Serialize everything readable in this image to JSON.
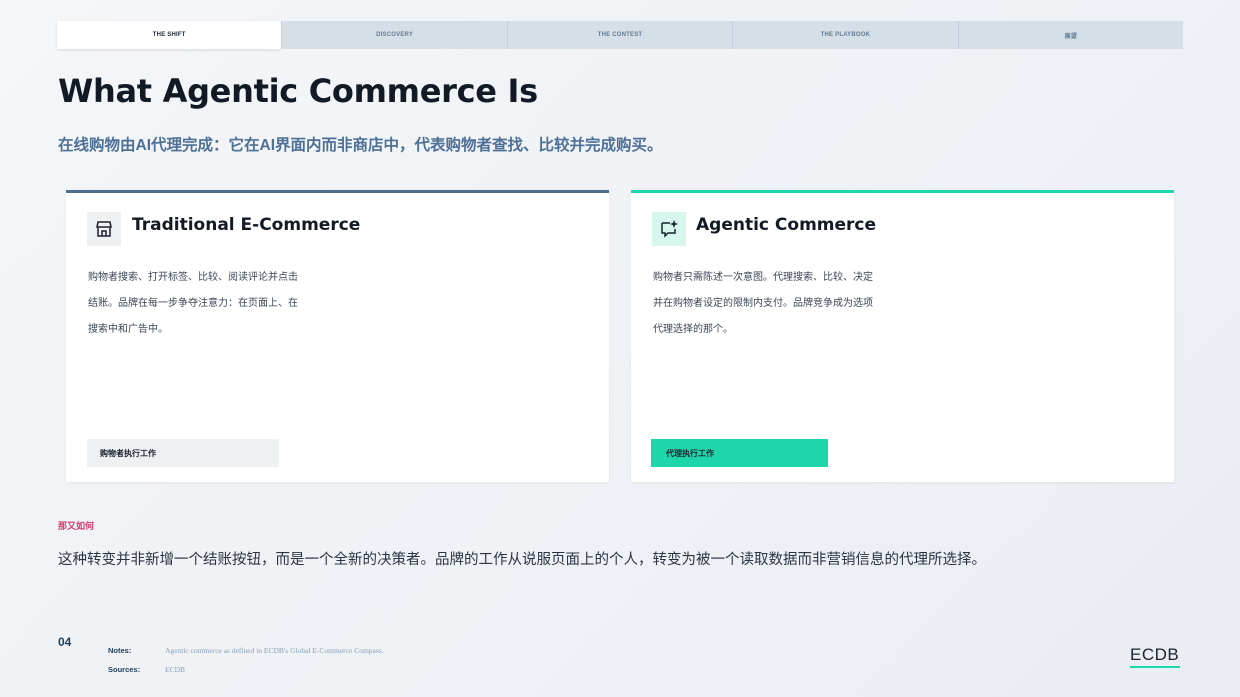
{
  "nav": {
    "tabs": [
      {
        "label": "THE SHIFT"
      },
      {
        "label": "DISCOVERY"
      },
      {
        "label": "THE CONTEST"
      },
      {
        "label": "THE PLAYBOOK"
      },
      {
        "label": "展望"
      }
    ],
    "active_index": 0
  },
  "page": {
    "title": "What Agentic Commerce Is",
    "subtitle": "在线购物由AI代理完成：它在AI界面内而非商店中，代表购物者查找、比较并完成购买。"
  },
  "cards": {
    "traditional": {
      "icon": "storefront-icon",
      "accent": "#4d6f8f",
      "title": "Traditional E-Commerce",
      "body_lines": [
        "购物者搜索、打开标签、比较、阅读评论并点击",
        "结账。品牌在每一步争夺注意力：在页面上、在",
        "搜索中和广告中。"
      ],
      "tag": "购物者执行工作"
    },
    "agentic": {
      "icon": "sparkle-chat-icon",
      "accent": "#1fd6ac",
      "title": "Agentic Commerce",
      "body_lines": [
        "购物者只需陈述一次意图。代理搜索、比较、决定",
        "并在购物者设定的限制内支付。品牌竞争成为选项",
        "代理选择的那个。"
      ],
      "tag": "代理执行工作"
    }
  },
  "so_what": {
    "label": "那又如何",
    "text": "这种转变并非新增一个结账按钮，而是一个全新的决策者。品牌的工作从说服页面上的个人，转变为被一个读取数据而非营销信息的代理所选择。"
  },
  "footer": {
    "page_number": "04",
    "notes_label": "Notes:",
    "notes_value": "Agentic commerce as defined in ECDB's Global E-Commerce Compass.",
    "sources_label": "Sources:",
    "sources_value": "ECDB",
    "logo": "ECDB"
  }
}
